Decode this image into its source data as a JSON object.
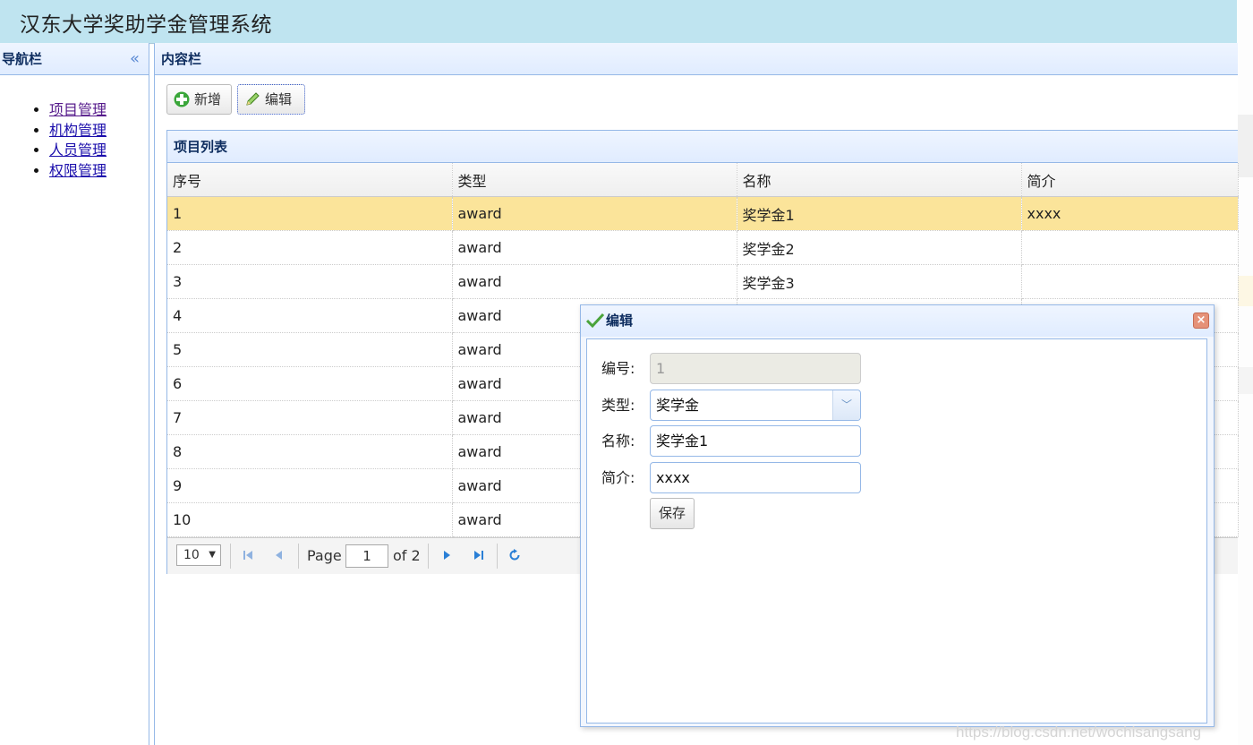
{
  "app": {
    "title": "汉东大学奖助学金管理系统",
    "watermark": "https://blog.csdn.net/wochisangsang"
  },
  "west": {
    "title": "导航栏",
    "collapse_icon": "double-chevron-left-icon",
    "items": [
      {
        "label": "项目管理"
      },
      {
        "label": "机构管理"
      },
      {
        "label": "人员管理"
      },
      {
        "label": "权限管理"
      }
    ]
  },
  "center": {
    "title": "内容栏",
    "toolbar": {
      "add_label": "新增",
      "add_icon": "add-icon",
      "edit_label": "编辑",
      "edit_icon": "pencil-icon"
    },
    "grid": {
      "title": "项目列表",
      "columns": [
        "序号",
        "类型",
        "名称",
        "简介"
      ],
      "rows": [
        [
          "1",
          "award",
          "奖学金1",
          "xxxx"
        ],
        [
          "2",
          "award",
          "奖学金2",
          ""
        ],
        [
          "3",
          "award",
          "奖学金3",
          ""
        ],
        [
          "4",
          "award",
          "",
          ""
        ],
        [
          "5",
          "award",
          "",
          ""
        ],
        [
          "6",
          "award",
          "",
          ""
        ],
        [
          "7",
          "award",
          "",
          ""
        ],
        [
          "8",
          "award",
          "",
          ""
        ],
        [
          "9",
          "award",
          "",
          ""
        ],
        [
          "10",
          "award",
          "",
          ""
        ]
      ],
      "selected_row": 0,
      "selected_color": "#fbe49a"
    },
    "pager": {
      "page_size": "10",
      "page_label": "Page",
      "page_number": "1",
      "of_label": "of 2"
    }
  },
  "dialog": {
    "title": "编辑",
    "title_icon": "checkmark-icon",
    "fields": {
      "id_label": "编号:",
      "id_value": "1",
      "type_label": "类型:",
      "type_value": "奖学金",
      "name_label": "名称:",
      "name_value": "奖学金1",
      "desc_label": "简介:",
      "desc_value": "xxxx"
    },
    "save_label": "保存"
  },
  "colors": {
    "header_bg": "#bfe4f0",
    "panel_border": "#95b8e7",
    "panel_title": "#0e2d5f",
    "close_button": "#e59278"
  }
}
